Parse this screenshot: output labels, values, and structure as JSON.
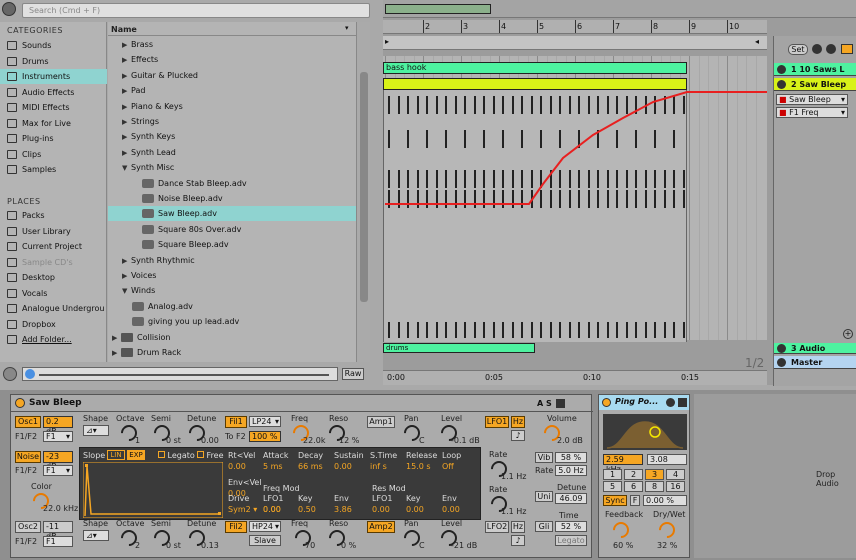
{
  "search": {
    "placeholder": "Search (Cmd + F)"
  },
  "categories": {
    "title": "CATEGORIES",
    "items": [
      "Sounds",
      "Drums",
      "Instruments",
      "Audio Effects",
      "MIDI Effects",
      "Max for Live",
      "Plug-ins",
      "Clips",
      "Samples"
    ]
  },
  "places": {
    "title": "PLACES",
    "items": [
      "Packs",
      "User Library",
      "Current Project",
      "Sample CD's",
      "Desktop",
      "Vocals",
      "Analogue Undergrou",
      "Dropbox",
      "Add Folder..."
    ]
  },
  "browser": {
    "header": "Name",
    "items": [
      {
        "label": "Brass",
        "type": "folder"
      },
      {
        "label": "Effects",
        "type": "folder"
      },
      {
        "label": "Guitar & Plucked",
        "type": "folder"
      },
      {
        "label": "Pad",
        "type": "folder"
      },
      {
        "label": "Piano & Keys",
        "type": "folder"
      },
      {
        "label": "Strings",
        "type": "folder"
      },
      {
        "label": "Synth Keys",
        "type": "folder"
      },
      {
        "label": "Synth Lead",
        "type": "folder"
      },
      {
        "label": "Synth Misc",
        "type": "open"
      },
      {
        "label": "Dance Stab Bleep.adv",
        "type": "file"
      },
      {
        "label": "Noise Bleep.adv",
        "type": "file"
      },
      {
        "label": "Saw Bleep.adv",
        "type": "file"
      },
      {
        "label": "Square 80s Over.adv",
        "type": "file"
      },
      {
        "label": "Square Bleep.adv",
        "type": "file"
      },
      {
        "label": "Synth Rhythmic",
        "type": "folder"
      },
      {
        "label": "Voices",
        "type": "folder"
      },
      {
        "label": "Winds",
        "type": "open"
      },
      {
        "label": "Analog.adv",
        "type": "file2"
      },
      {
        "label": "giving you up lead.adv",
        "type": "file2"
      },
      {
        "label": "Collision",
        "type": "dev"
      },
      {
        "label": "Drum Rack",
        "type": "dev"
      }
    ]
  },
  "arrangement": {
    "ruler": [
      "2",
      "3",
      "4",
      "5",
      "6",
      "7",
      "8",
      "9",
      "10"
    ],
    "set_label": "Set",
    "clip1": "bass hook",
    "clip_drums": "drums",
    "fraction": "1/2",
    "times": [
      "0:00",
      "0:05",
      "0:10",
      "0:15"
    ]
  },
  "tracks": [
    {
      "name": "1 10 Saws L"
    },
    {
      "name": "2 Saw Bleep"
    }
  ],
  "track_controls": {
    "device": "Saw Bleep",
    "param": "F1 Freq"
  },
  "bottom_tracks": [
    {
      "name": "3 Audio"
    },
    {
      "name": "Master"
    }
  ],
  "raw_label": "Raw",
  "device": {
    "title": "Saw Bleep",
    "osc1": {
      "label": "Osc1",
      "level": "0.2 dB",
      "f1f2": "F1/F2",
      "route": "F1",
      "shape": "Shape",
      "octave_label": "Octave",
      "octave": "1",
      "semi_label": "Semi",
      "semi": "0 st",
      "detune_label": "Detune",
      "detune": "0.00"
    },
    "noise": {
      "label": "Noise",
      "level": "-23 dB",
      "f1f2": "F1/F2",
      "route": "F1",
      "color_label": "Color",
      "color": "22.0 kHz"
    },
    "osc2": {
      "label": "Osc2",
      "level": "-11 dB",
      "f1f2": "F1/F2",
      "route": "F1",
      "shape": "Shape",
      "octave_label": "Octave",
      "octave": "2",
      "semi_label": "Semi",
      "semi": "0 st",
      "detune_label": "Detune",
      "detune": "0.13"
    },
    "env": {
      "slope": "Slope",
      "lin": "LIN",
      "exp": "EXP",
      "legato": "Legato",
      "free": "Free",
      "cols": [
        "Rt<Vel",
        "Attack",
        "Decay",
        "Sustain",
        "S.Time",
        "Release",
        "Loop"
      ],
      "vals": [
        "0.00",
        "5 ms",
        "66 ms",
        "0.00",
        "inf s",
        "15.0 s",
        "Off"
      ],
      "envvel": "Env<Vel",
      "envvel_val": "0.00",
      "drive": "Drive",
      "drive_val": "Sym2",
      "freqmod": "Freq Mod",
      "resmod": "Res Mod",
      "lfo1": "LFO1",
      "key": "Key",
      "envlbl": "Env",
      "fm_vals": [
        "0.00",
        "0.50",
        "3.86"
      ],
      "rm_vals": [
        "0.00",
        "0.00",
        "0.00"
      ],
      "drive_num": "0.00"
    },
    "fil1": {
      "label": "Fil1",
      "type": "LP24",
      "tof2": "To F2",
      "pct": "100 %",
      "freq_label": "Freq",
      "freq": "22.0k",
      "reso_label": "Reso",
      "reso": "12 %"
    },
    "fil2": {
      "label": "Fil2",
      "type": "HP24",
      "slave": "Slave",
      "freq_label": "Freq",
      "freq": "70",
      "reso_label": "Reso",
      "reso": "0 %"
    },
    "amp1": {
      "label": "Amp1",
      "pan_label": "Pan",
      "pan": "C",
      "level_label": "Level",
      "level": "-0.1 dB"
    },
    "amp2": {
      "label": "Amp2",
      "pan_label": "Pan",
      "pan": "C",
      "level_label": "Level",
      "level": "-21 dB"
    },
    "lfo1": {
      "label": "LFO1",
      "hz": "Hz",
      "rate_label": "Rate",
      "rate": "1.1 Hz"
    },
    "lfo2": {
      "label": "LFO2",
      "hz": "Hz",
      "rate_label": "Rate",
      "rate": "1.1 Hz"
    },
    "volume_label": "Volume",
    "volume": "2.0 dB",
    "vib": "Vib",
    "vib_val": "58 %",
    "rate": "Rate",
    "rate_val": "5.0 Hz",
    "uni": "Uni",
    "detune_label": "Detune",
    "detune": "46.09",
    "gli": "Gli",
    "time_label": "Time",
    "time": "52 %",
    "legato": "Legato"
  },
  "pingpong": {
    "title": "Ping Po...",
    "freq": "2.59 kHz",
    "q": "3.08",
    "grid": [
      "1",
      "2",
      "3",
      "4",
      "5",
      "6",
      "8",
      "16"
    ],
    "sync": "Sync",
    "f": "F",
    "pct": "0.00 %",
    "feedback_label": "Feedback",
    "feedback": "60 %",
    "drywet_label": "Dry/Wet",
    "drywet": "32 %"
  },
  "drop_audio": "Drop Audio"
}
